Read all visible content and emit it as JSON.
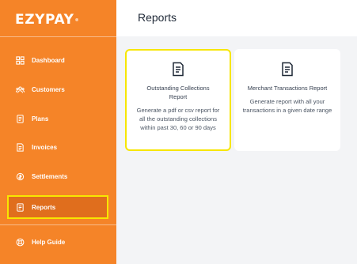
{
  "app": {
    "brand": "EZYPAY",
    "trademark": "®"
  },
  "sidebar": {
    "items": [
      {
        "label": "Dashboard",
        "icon": "dashboard-icon"
      },
      {
        "label": "Customers",
        "icon": "customers-icon"
      },
      {
        "label": "Plans",
        "icon": "plans-icon"
      },
      {
        "label": "Invoices",
        "icon": "invoices-icon"
      },
      {
        "label": "Settlements",
        "icon": "settlements-icon"
      },
      {
        "label": "Reports",
        "icon": "reports-icon",
        "active": true
      }
    ],
    "help": {
      "label": "Help Guide",
      "icon": "help-icon"
    }
  },
  "header": {
    "title": "Reports"
  },
  "cards": [
    {
      "title": "Outstanding Collections Report",
      "description": "Generate a pdf or csv report for all the outstanding collections within past 30, 60 or 90 days",
      "icon": "report-document-icon"
    },
    {
      "title": "Merchant Transactions Report",
      "description": "Generate report with all your transactions in a given date range",
      "icon": "report-document-icon"
    }
  ],
  "colors": {
    "sidebar": "#f58428",
    "active_item": "#e06e1d",
    "highlight": "#f7e600",
    "background": "#f3f4f6"
  }
}
